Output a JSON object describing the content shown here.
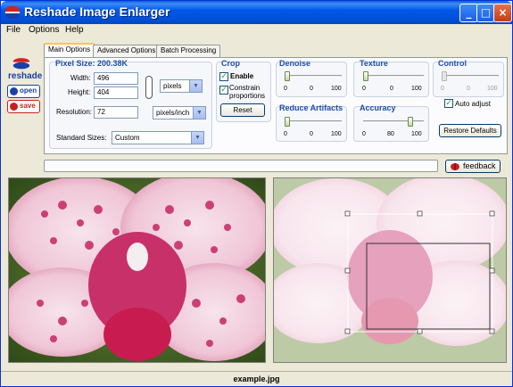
{
  "window": {
    "title": "Reshade Image Enlarger",
    "min": "_",
    "max": "□",
    "close": "×"
  },
  "menu": [
    "File",
    "Options",
    "Help"
  ],
  "sidebar": {
    "logo_text": "reshade",
    "open_label": "open",
    "save_label": "save"
  },
  "tabs": [
    "Main Options",
    "Advanced Options",
    "Batch Processing"
  ],
  "size_group": {
    "title": "Pixel Size: 200.38K",
    "width_label": "Width:",
    "width_value": "496",
    "height_label": "Height:",
    "height_value": "404",
    "unit": "pixels",
    "resolution_label": "Resolution:",
    "resolution_value": "72",
    "resolution_unit": "pixels/inch",
    "standard_label": "Standard Sizes:",
    "standard_value": "Custom"
  },
  "crop": {
    "title": "Crop",
    "enable_label": "Enable",
    "constrain_label": "Constrain proportions",
    "reset_label": "Reset"
  },
  "sliders": {
    "denoise": {
      "title": "Denoise",
      "value": 0,
      "ticks": [
        "0",
        "0",
        "100"
      ]
    },
    "texture": {
      "title": "Texture",
      "value": 0,
      "ticks": [
        "0",
        "0",
        "100"
      ]
    },
    "control": {
      "title": "Control",
      "value": 0,
      "ticks": [
        "0",
        "0",
        "100"
      ]
    },
    "artifacts": {
      "title": "Reduce Artifacts",
      "value": 0,
      "ticks": [
        "0",
        "0",
        "100"
      ]
    },
    "accuracy": {
      "title": "Accuracy",
      "value": 80,
      "ticks": [
        "0",
        "80",
        "100"
      ]
    }
  },
  "control": {
    "auto_adjust_label": "Auto adjust",
    "restore_label": "Restore Defaults"
  },
  "feedback_label": "feedback",
  "status": {
    "filename": "example.jpg"
  },
  "colors": {
    "title_bar": "#0058e8",
    "accent": "#1f4ea8",
    "orchid": "#c8306a"
  }
}
